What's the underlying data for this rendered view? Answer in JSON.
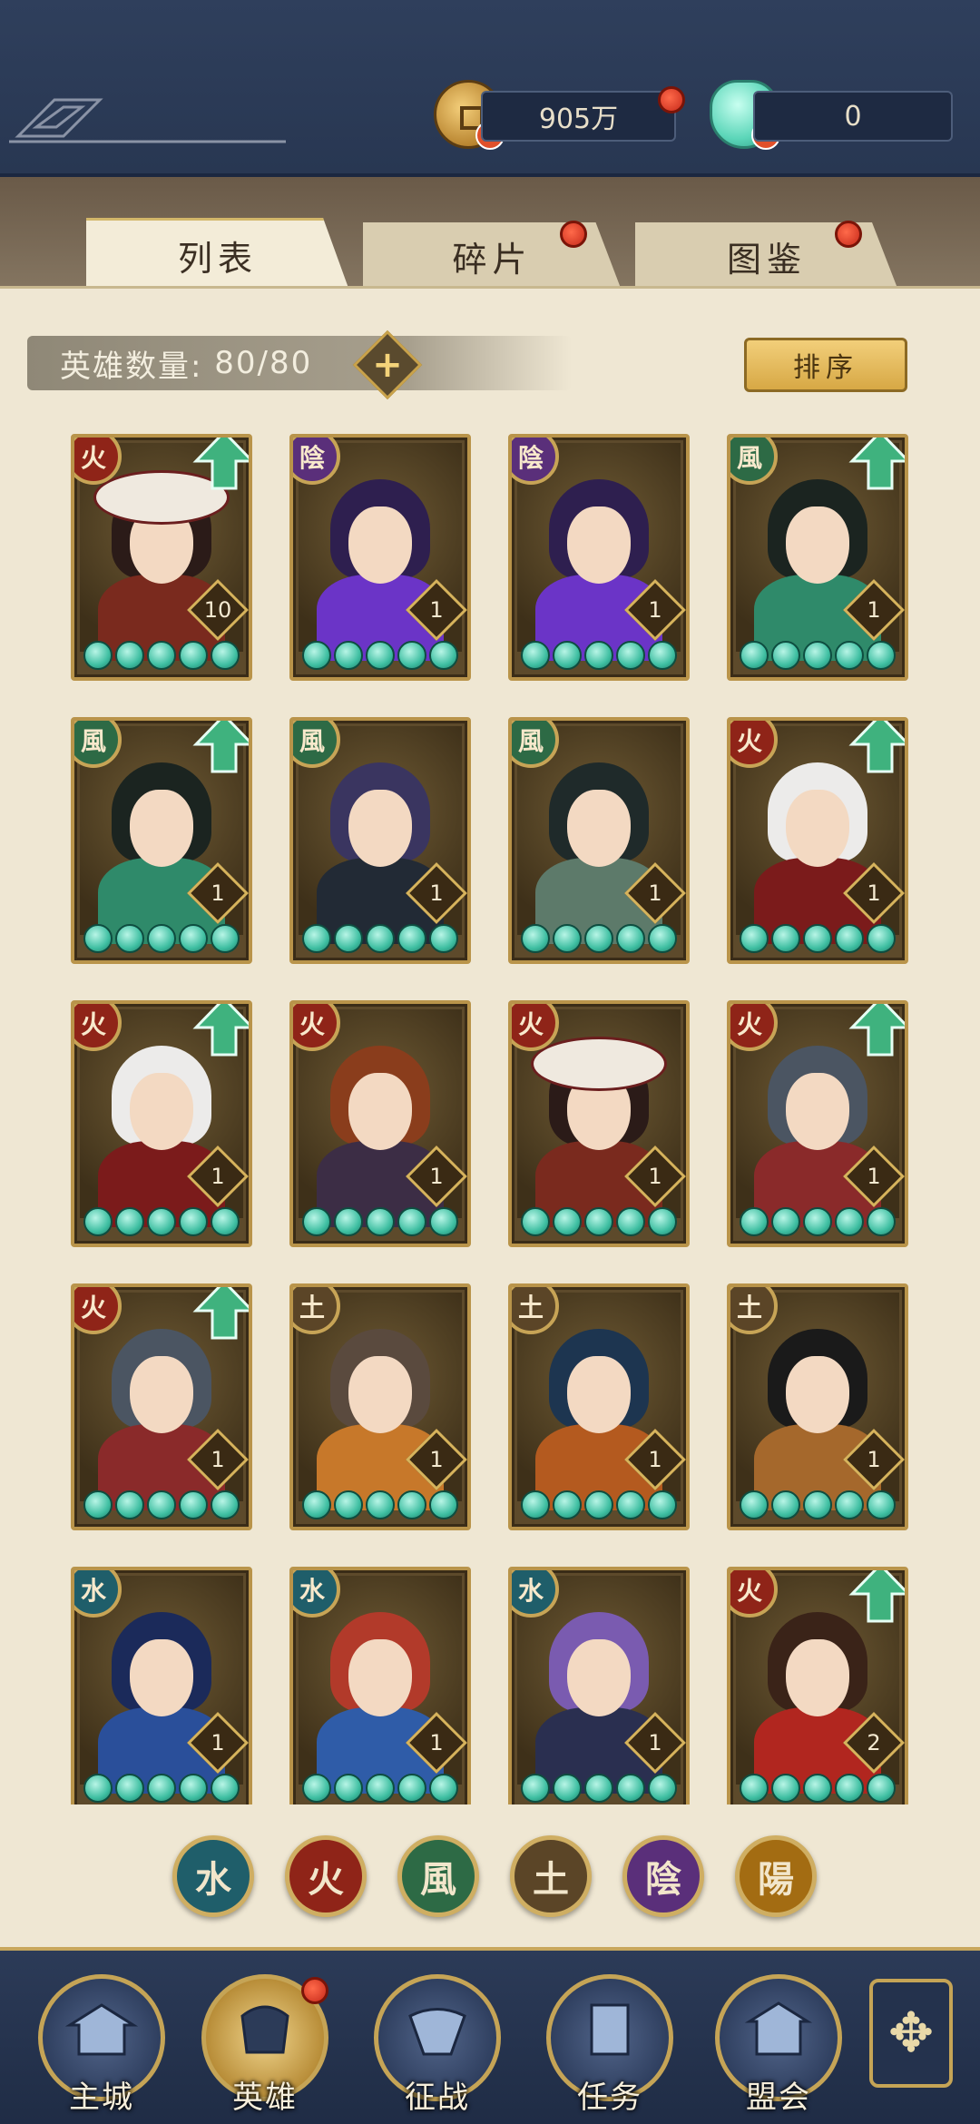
{
  "resources": {
    "coins": "905万",
    "gems": "0"
  },
  "tabs": [
    {
      "label": "列表",
      "active": true
    },
    {
      "label": "碎片",
      "active": false
    },
    {
      "label": "图鉴",
      "active": false
    }
  ],
  "hero_count": {
    "label": "英雄数量:",
    "value": "80/80"
  },
  "sort_label": "排序",
  "add_icon": "plus-icon",
  "colors": {
    "fire": "#8f2418",
    "shadow": "#5a2f7a",
    "wind": "#2d6a45",
    "earth": "#5b4527",
    "water": "#1f5e6a",
    "light": "#a36c12",
    "upgrade": "#3fb27e"
  },
  "heroes": [
    {
      "element": "火",
      "el": "fire",
      "level": "10",
      "upgrade": true,
      "skin": "#7a2a1e",
      "hair": "#2b1b18",
      "hat": true
    },
    {
      "element": "陰",
      "el": "shadow",
      "level": "1",
      "upgrade": false,
      "skin": "#6b34c7",
      "hair": "#2e1f4f",
      "hat": false
    },
    {
      "element": "陰",
      "el": "shadow",
      "level": "1",
      "upgrade": false,
      "skin": "#6b34c7",
      "hair": "#2e1f4f",
      "hat": false
    },
    {
      "element": "風",
      "el": "wind",
      "level": "1",
      "upgrade": true,
      "skin": "#2f8a6a",
      "hair": "#1b2420",
      "hat": false
    },
    {
      "element": "風",
      "el": "wind",
      "level": "1",
      "upgrade": true,
      "skin": "#2f8a6a",
      "hair": "#1b2420",
      "hat": false
    },
    {
      "element": "風",
      "el": "wind",
      "level": "1",
      "upgrade": false,
      "skin": "#222a35",
      "hair": "#3a3560",
      "hat": false
    },
    {
      "element": "風",
      "el": "wind",
      "level": "1",
      "upgrade": false,
      "skin": "#5d7a6a",
      "hair": "#1f2a2a",
      "hat": false
    },
    {
      "element": "火",
      "el": "fire",
      "level": "1",
      "upgrade": true,
      "skin": "#7b1b1b",
      "hair": "#ecebea",
      "hat": false
    },
    {
      "element": "火",
      "el": "fire",
      "level": "1",
      "upgrade": true,
      "skin": "#7b1b1b",
      "hair": "#ecebea",
      "hat": false
    },
    {
      "element": "火",
      "el": "fire",
      "level": "1",
      "upgrade": false,
      "skin": "#3c2d45",
      "hair": "#8a3d1c",
      "hat": false
    },
    {
      "element": "火",
      "el": "fire",
      "level": "1",
      "upgrade": false,
      "skin": "#7a2a1e",
      "hair": "#2b1b18",
      "hat": true
    },
    {
      "element": "火",
      "el": "fire",
      "level": "1",
      "upgrade": true,
      "skin": "#8a2a2a",
      "hair": "#4b5562",
      "hat": false
    },
    {
      "element": "火",
      "el": "fire",
      "level": "1",
      "upgrade": true,
      "skin": "#8a2a2a",
      "hair": "#4b5562",
      "hat": false
    },
    {
      "element": "土",
      "el": "earth",
      "level": "1",
      "upgrade": false,
      "skin": "#c7782a",
      "hair": "#5a4a3e",
      "hat": false
    },
    {
      "element": "土",
      "el": "earth",
      "level": "1",
      "upgrade": false,
      "skin": "#b45a1f",
      "hair": "#1d3550",
      "hat": false
    },
    {
      "element": "土",
      "el": "earth",
      "level": "1",
      "upgrade": false,
      "skin": "#a5682c",
      "hair": "#1a1a1a",
      "hat": false
    },
    {
      "element": "水",
      "el": "water",
      "level": "1",
      "upgrade": false,
      "skin": "#2a4f9a",
      "hair": "#1b2a5a",
      "hat": false
    },
    {
      "element": "水",
      "el": "water",
      "level": "1",
      "upgrade": false,
      "skin": "#2f5ca8",
      "hair": "#b23a2a",
      "hat": false
    },
    {
      "element": "水",
      "el": "water",
      "level": "1",
      "upgrade": false,
      "skin": "#2a2f50",
      "hair": "#7a5bb0",
      "hat": false
    },
    {
      "element": "火",
      "el": "fire",
      "level": "2",
      "upgrade": true,
      "skin": "#b1261f",
      "hair": "#3a2318",
      "hat": false
    }
  ],
  "filters": [
    {
      "label": "水",
      "el": "water"
    },
    {
      "label": "火",
      "el": "fire"
    },
    {
      "label": "風",
      "el": "wind"
    },
    {
      "label": "土",
      "el": "earth"
    },
    {
      "label": "陰",
      "el": "shadow"
    },
    {
      "label": "陽",
      "el": "light"
    }
  ],
  "nav": [
    {
      "label": "主城",
      "icon": "city-icon",
      "active": false
    },
    {
      "label": "英雄",
      "icon": "hero-icon",
      "active": true
    },
    {
      "label": "征战",
      "icon": "campaign-icon",
      "active": false
    },
    {
      "label": "任务",
      "icon": "quest-icon",
      "active": false
    },
    {
      "label": "盟会",
      "icon": "guild-icon",
      "active": false
    }
  ],
  "more_icon": "menu-icon"
}
